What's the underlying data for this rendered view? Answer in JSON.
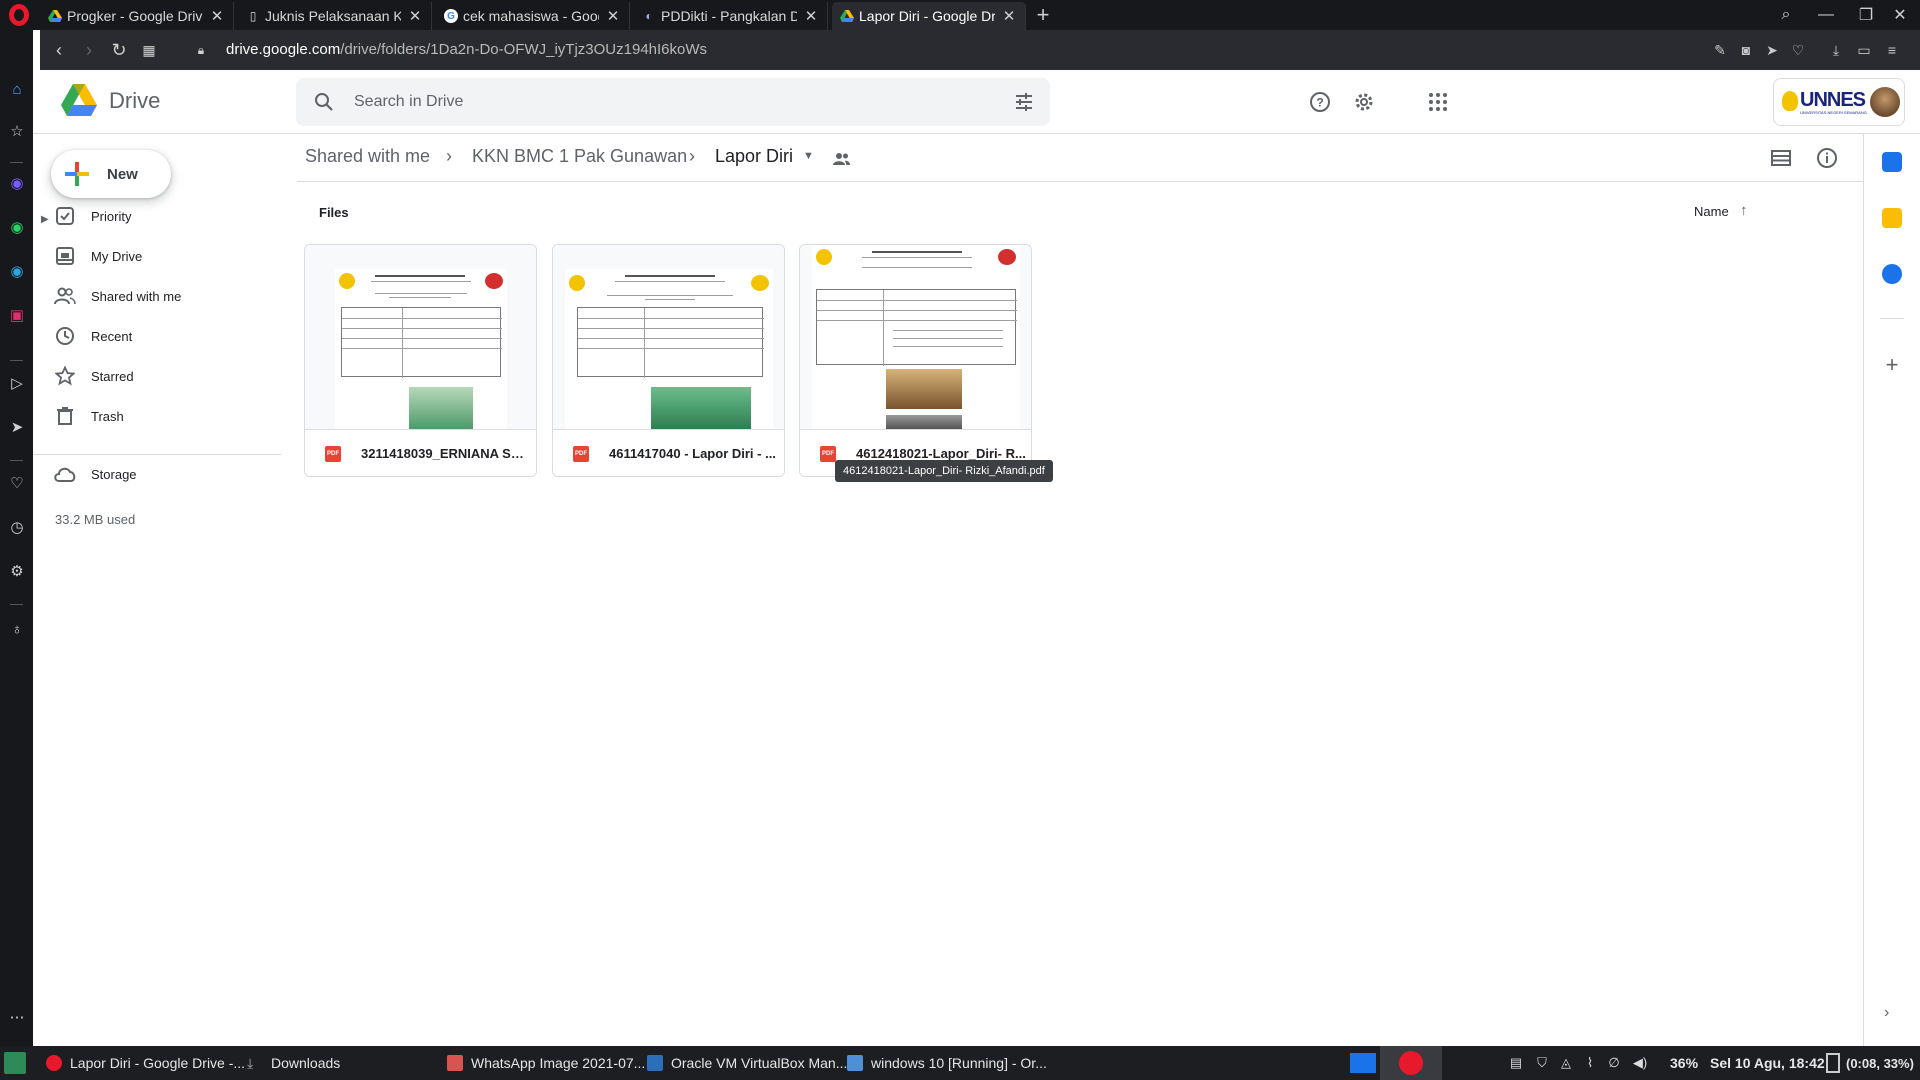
{
  "browser": {
    "tabs": [
      {
        "title": "Progker - Google Drive",
        "favicon": "drive-icon"
      },
      {
        "title": "Juknis Pelaksanaan KKN",
        "favicon": "document-icon"
      },
      {
        "title": "cek mahasiswa - Google",
        "favicon": "google-icon"
      },
      {
        "title": "PDDikti - Pangkalan Dat",
        "favicon": "pddikti-icon"
      },
      {
        "title": "Lapor Diri - Google Drive",
        "favicon": "drive-icon",
        "active": true
      }
    ],
    "url_host": "drive.google.com",
    "url_path": "/drive/folders/1Da2n-Do-OFWJ_iyTjz3OUz194hI6koWs"
  },
  "drive": {
    "app_title": "Drive",
    "search_placeholder": "Search in Drive",
    "account_logo_text": "UNNES",
    "account_logo_subtext": "UNIVERSITAS NEGERI SEMARANG"
  },
  "nav": {
    "new_label": "New",
    "items": [
      {
        "label": "Priority",
        "icon": "priority-check-icon"
      },
      {
        "label": "My Drive",
        "icon": "my-drive-icon"
      },
      {
        "label": "Shared with me",
        "icon": "people-icon"
      },
      {
        "label": "Recent",
        "icon": "clock-icon"
      },
      {
        "label": "Starred",
        "icon": "star-icon"
      },
      {
        "label": "Trash",
        "icon": "trash-icon"
      }
    ],
    "storage_label": "Storage",
    "storage_used": "33.2 MB used"
  },
  "breadcrumb": {
    "items": [
      "Shared with me",
      "KKN BMC 1 Pak Gunawan",
      "Lapor Diri"
    ]
  },
  "content": {
    "section_label": "Files",
    "sort_label": "Name",
    "files": [
      {
        "name": "3211418039_ERNIANA SU...",
        "type": "pdf"
      },
      {
        "name": "4611417040 - Lapor Diri - ...",
        "type": "pdf"
      },
      {
        "name": "4612418021-Lapor_Diri- R...",
        "type": "pdf"
      }
    ],
    "tooltip": "4612418021-Lapor_Diri- Rizki_Afandi.pdf"
  },
  "taskbar": {
    "items": [
      {
        "label": "Lapor Diri - Google Drive -..."
      },
      {
        "label": "Downloads"
      },
      {
        "label": "WhatsApp Image 2021-07..."
      },
      {
        "label": "Oracle VM VirtualBox Man..."
      },
      {
        "label": "windows 10 [Running] - Or..."
      }
    ],
    "battery": "36%",
    "clock": "Sel 10 Agu, 18:42",
    "battery_time": "(0:08, 33%)"
  },
  "colors": {
    "brand_blue": "#1a73e8",
    "pdf_red": "#ea4335",
    "opera_red": "#e8192c"
  }
}
